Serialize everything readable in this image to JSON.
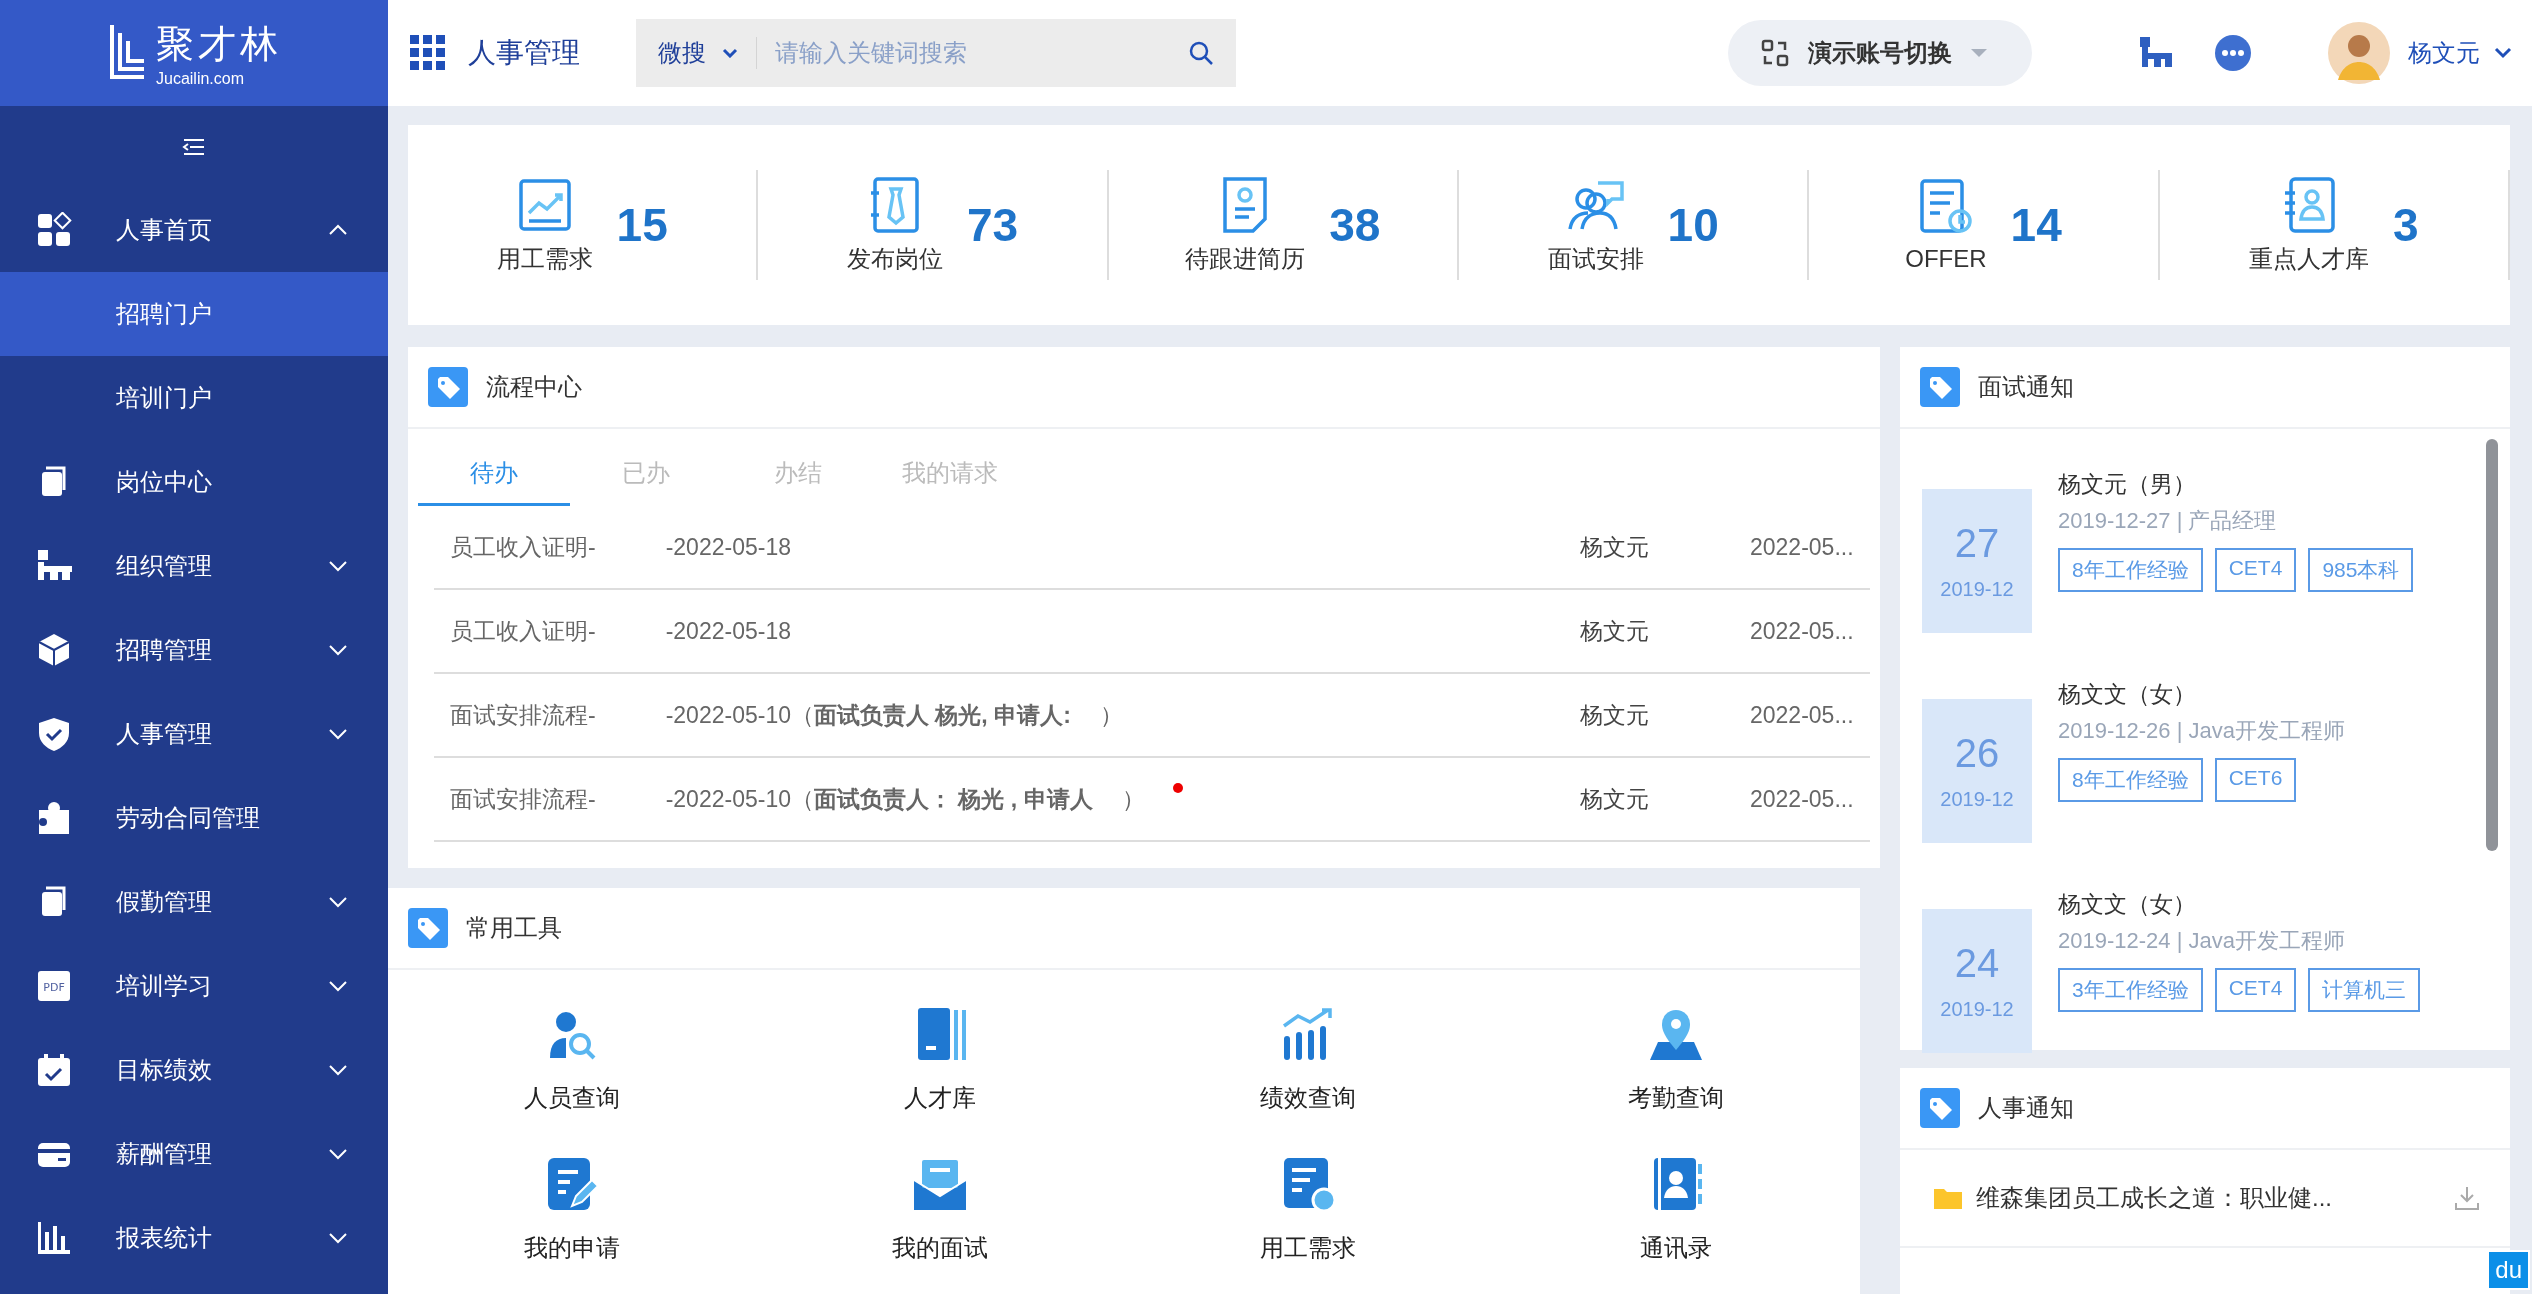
{
  "brand": {
    "name": "聚才林",
    "domain": "Jucailin.com"
  },
  "header": {
    "module": "人事管理",
    "search": {
      "scope": "微搜",
      "placeholder": "请输入关键词搜索"
    },
    "account_switch": "演示账号切换",
    "user": "杨文元"
  },
  "sidebar": {
    "items": [
      {
        "label": "人事首页",
        "kind": "group",
        "expanded": true,
        "children": [
          {
            "label": "招聘门户",
            "selected": true
          },
          {
            "label": "培训门户",
            "selected": false
          }
        ]
      },
      {
        "label": "岗位中心",
        "kind": "link"
      },
      {
        "label": "组织管理",
        "kind": "group",
        "expanded": false
      },
      {
        "label": "招聘管理",
        "kind": "group",
        "expanded": false
      },
      {
        "label": "人事管理",
        "kind": "group",
        "expanded": false
      },
      {
        "label": "劳动合同管理",
        "kind": "link"
      },
      {
        "label": "假勤管理",
        "kind": "group",
        "expanded": false
      },
      {
        "label": "培训学习",
        "kind": "group",
        "expanded": false,
        "icon_text": "PDF"
      },
      {
        "label": "目标绩效",
        "kind": "group",
        "expanded": false
      },
      {
        "label": "薪酬管理",
        "kind": "group",
        "expanded": false
      },
      {
        "label": "报表统计",
        "kind": "group",
        "expanded": false
      }
    ]
  },
  "stats": [
    {
      "label": "用工需求",
      "value": "15"
    },
    {
      "label": "发布岗位",
      "value": "73"
    },
    {
      "label": "待跟进简历",
      "value": "38"
    },
    {
      "label": "面试安排",
      "value": "10"
    },
    {
      "label": "OFFER",
      "value": "14"
    },
    {
      "label": "重点人才库",
      "value": "3"
    }
  ],
  "process_center": {
    "title": "流程中心",
    "tabs": [
      {
        "label": "待办",
        "selected": true
      },
      {
        "label": "已办",
        "selected": false
      },
      {
        "label": "办结",
        "selected": false
      },
      {
        "label": "我的请求",
        "selected": false
      }
    ],
    "rows": [
      {
        "title_start": "员工收入证明-",
        "title_end": "-2022-05-18",
        "person": "杨文元",
        "date": "2022-05...",
        "unread": false
      },
      {
        "title_start": "员工收入证明-",
        "title_end": "-2022-05-18",
        "person": "杨文元",
        "date": "2022-05...",
        "unread": false
      },
      {
        "title_start": "面试安排流程-",
        "title_end": "-2022-05-10（**面试负责人 杨光, 申请人:**　 ）",
        "person": "杨文元",
        "date": "2022-05...",
        "unread": false
      },
      {
        "title_start": "面试安排流程-",
        "title_end": "-2022-05-10（**面试负责人： 杨光 , 申请人**　 ）",
        "person": "杨文元",
        "date": "2022-05...",
        "unread": true
      }
    ]
  },
  "tools": {
    "title": "常用工具",
    "items": [
      "人员查询",
      "人才库",
      "绩效查询",
      "考勤查询",
      "我的申请",
      "我的面试",
      "用工需求",
      "通讯录"
    ]
  },
  "interview_notice": {
    "title": "面试通知",
    "items": [
      {
        "day": "27",
        "month": "2019-12",
        "name": "杨文元（男）",
        "detail": "2019-12-27 | 产品经理",
        "tags": [
          "8年工作经验",
          "CET4",
          "985本科"
        ]
      },
      {
        "day": "26",
        "month": "2019-12",
        "name": "杨文文（女）",
        "detail": "2019-12-26 | Java开发工程师",
        "tags": [
          "8年工作经验",
          "CET6"
        ]
      },
      {
        "day": "24",
        "month": "2019-12",
        "name": "杨文文（女）",
        "detail": "2019-12-24 | Java开发工程师",
        "tags": [
          "3年工作经验",
          "CET4",
          "计算机三"
        ]
      }
    ]
  },
  "hr_notice": {
    "title": "人事通知",
    "items": [
      "维森集团员工成长之道：职业健..."
    ]
  },
  "floating_badge": "du"
}
